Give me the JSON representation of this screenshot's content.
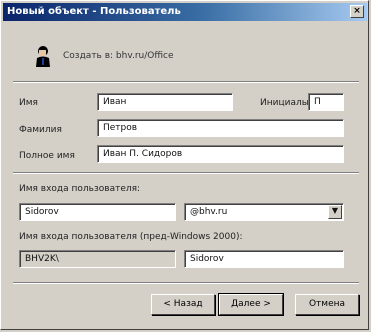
{
  "window": {
    "title": "Новый объект - Пользователь",
    "close_glyph": "×"
  },
  "header": {
    "create_in": "Создать в: bhv.ru/Office"
  },
  "form": {
    "first_name_label": "Имя",
    "first_name_value": "Иван",
    "initials_label": "Инициалы",
    "initials_value": "П",
    "last_name_label": "Фамилия",
    "last_name_value": "Петров",
    "full_name_label": "Полное имя",
    "full_name_value": "Иван П. Сидоров",
    "logon_label": "Имя входа пользователя:",
    "logon_value": "Sidorov",
    "domain_value": "@bhv.ru",
    "pre2000_label": "Имя входа пользователя (пред-Windows 2000):",
    "pre2000_domain_value": "BHV2K\\",
    "pre2000_name_value": "Sidorov"
  },
  "buttons": {
    "back_label": "< Назад",
    "next_label": "Далее >",
    "cancel_label": "Отмена"
  },
  "icons": {
    "user_icon": "user-icon",
    "combo_arrow": "▼"
  },
  "colors": {
    "titlebar_start": "#0a246a",
    "titlebar_end": "#a6caf0",
    "face": "#d4d0c8"
  }
}
